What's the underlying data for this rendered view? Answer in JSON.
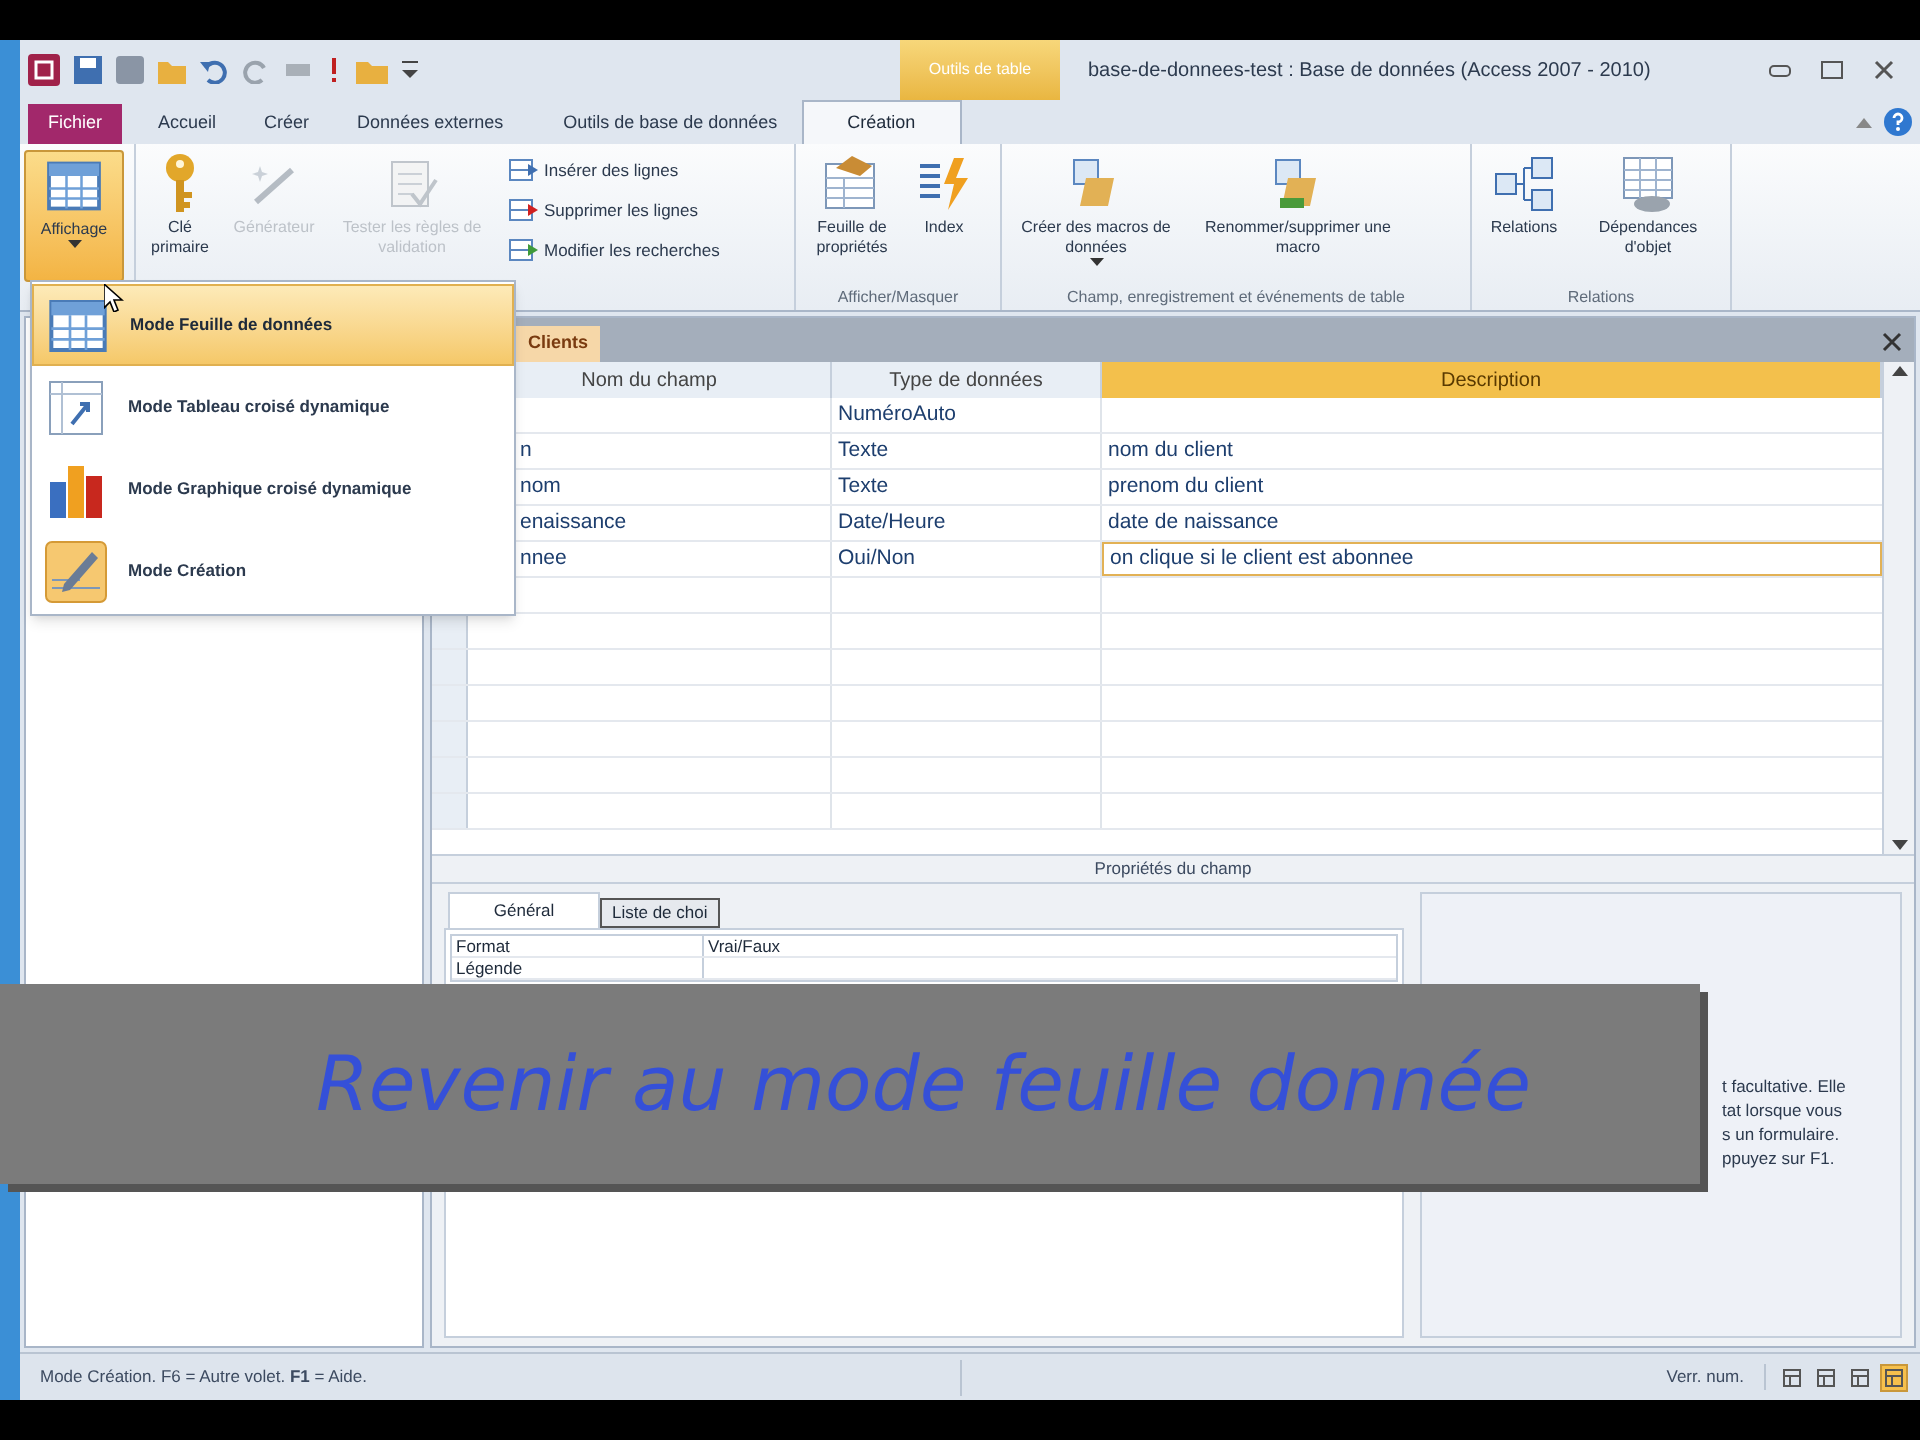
{
  "window": {
    "context_tab": "Outils de table",
    "title": "base-de-donnees-test : Base de données (Access 2007 - 2010)"
  },
  "ribbon_tabs": [
    {
      "label": "Fichier",
      "kind": "file",
      "selected": false
    },
    {
      "label": "Accueil",
      "kind": "tab",
      "selected": false
    },
    {
      "label": "Créer",
      "kind": "tab",
      "selected": false
    },
    {
      "label": "Données externes",
      "kind": "tab",
      "selected": false
    },
    {
      "label": "Outils de base de données",
      "kind": "tab",
      "selected": false
    },
    {
      "label": "Création",
      "kind": "tab",
      "selected": true
    }
  ],
  "ribbon_groups": [
    {
      "buttons": [
        {
          "label": "Affichage",
          "kind": "large",
          "disabled": false,
          "pressed": true,
          "dropdown": true
        }
      ]
    },
    {
      "buttons": [
        {
          "label": "Clé primaire",
          "kind": "large",
          "disabled": false,
          "pressed": false,
          "dropdown": false
        },
        {
          "label": "Générateur",
          "kind": "large",
          "disabled": true,
          "pressed": false,
          "dropdown": false
        },
        {
          "label": "Tester les règles de validation",
          "kind": "large",
          "disabled": true,
          "pressed": false,
          "dropdown": false
        },
        {
          "label": "Insérer des lignes",
          "kind": "small",
          "disabled": false,
          "pressed": false,
          "dropdown": false
        },
        {
          "label": "Supprimer les lignes",
          "kind": "small",
          "disabled": false,
          "pressed": false,
          "dropdown": false
        },
        {
          "label": "Modifier les recherches",
          "kind": "small",
          "disabled": false,
          "pressed": false,
          "dropdown": false
        }
      ]
    },
    {
      "label": "Afficher/Masquer",
      "buttons": [
        {
          "label": "Feuille de propriétés",
          "kind": "large",
          "disabled": false,
          "pressed": false,
          "dropdown": false
        },
        {
          "label": "Index",
          "kind": "large",
          "disabled": false,
          "pressed": false,
          "dropdown": false
        }
      ]
    },
    {
      "label": "Champ, enregistrement et événements de table",
      "buttons": [
        {
          "label": "Créer des macros de données",
          "kind": "large",
          "disabled": false,
          "pressed": false,
          "dropdown": true
        },
        {
          "label": "Renommer/supprimer une macro",
          "kind": "large",
          "disabled": false,
          "pressed": false,
          "dropdown": false
        }
      ]
    },
    {
      "label": "Relations",
      "buttons": [
        {
          "label": "Relations",
          "kind": "large",
          "disabled": false,
          "pressed": false,
          "dropdown": false
        },
        {
          "label": "Dépendances d'objet",
          "kind": "large",
          "disabled": false,
          "pressed": false,
          "dropdown": false
        }
      ]
    }
  ],
  "view_menu": {
    "items": [
      {
        "label": "Mode Feuille de données",
        "selected": true
      },
      {
        "label": "Mode Tableau croisé dynamique",
        "selected": false
      },
      {
        "label": "Mode Graphique croisé dynamique",
        "selected": false
      },
      {
        "label": "Mode Création",
        "selected": false
      }
    ]
  },
  "document": {
    "tab": "Clients",
    "columns": [
      {
        "label": "Nom du champ",
        "selected": false
      },
      {
        "label": "Type de données",
        "selected": false
      },
      {
        "label": "Description",
        "selected": true
      }
    ],
    "rows": [
      {
        "type": "NuméroAuto",
        "editing": false
      },
      {
        "name": "n",
        "type": "Texte",
        "description": "nom du client",
        "editing": false
      },
      {
        "name": "nom",
        "type": "Texte",
        "description": "prenom du client",
        "editing": false
      },
      {
        "name": "enaissance",
        "type": "Date/Heure",
        "description": "date de naissance",
        "editing": false
      },
      {
        "name": "nnee",
        "type": "Oui/Non",
        "description": "on clique si le client est abonnee",
        "editing": true
      }
    ]
  },
  "field_properties": {
    "title": "Propriétés du champ",
    "tabs": [
      {
        "label": "Général",
        "selected": true
      },
      {
        "label": "Liste de choi",
        "selected": false
      }
    ],
    "rows": [
      {
        "label": "Format",
        "value": "Vrai/Faux"
      },
      {
        "label": "Légende"
      }
    ],
    "help_lines": [
      "t facultative. Elle",
      "tat lorsque vous",
      "s un formulaire.",
      "ppuyez sur F1."
    ]
  },
  "caption": "Revenir au mode feuille donnée",
  "status_bar": {
    "text": "Mode Création. F6 = Autre volet. **F1** = Aide.",
    "indicator": "Verr. num.",
    "views": [
      {
        "selected": false
      },
      {
        "selected": false
      },
      {
        "selected": false
      },
      {
        "selected": true
      }
    ]
  }
}
